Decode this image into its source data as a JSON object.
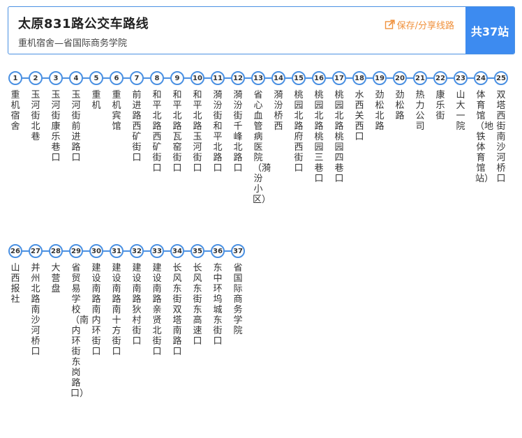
{
  "header": {
    "title": "太原831路公交车路线",
    "subtitle": "重机宿舍—省国际商务学院",
    "save_label": "保存/分享线路",
    "count_label": "共37站"
  },
  "colors": {
    "accent": "#3d8bf0",
    "line": "#4a90e2",
    "save": "#f0913c"
  },
  "rows": [
    {
      "stops": [
        {
          "num": "1",
          "name": "重机宿舍"
        },
        {
          "num": "2",
          "name": "玉河街北巷"
        },
        {
          "num": "3",
          "name": "玉河街康乐巷口"
        },
        {
          "num": "4",
          "name": "玉河街前进路口"
        },
        {
          "num": "5",
          "name": "重机"
        },
        {
          "num": "6",
          "name": "重机宾馆"
        },
        {
          "num": "7",
          "name": "前进路西矿街口"
        },
        {
          "num": "8",
          "name": "和平北路西矿街口"
        },
        {
          "num": "9",
          "name": "和平北路瓦窑街口"
        },
        {
          "num": "10",
          "name": "和平北路玉河街口"
        },
        {
          "num": "11",
          "name": "漪汾街和平北路口"
        },
        {
          "num": "12",
          "name": "漪汾街千峰北路口"
        },
        {
          "num": "13",
          "name": "省心血管病医院（漪汾小区）"
        },
        {
          "num": "14",
          "name": "漪汾桥西"
        },
        {
          "num": "15",
          "name": "桃园北路府西街口"
        },
        {
          "num": "16",
          "name": "桃园北路桃园三巷口"
        },
        {
          "num": "17",
          "name": "桃园北路桃园四巷口"
        },
        {
          "num": "18",
          "name": "水西关西口"
        },
        {
          "num": "19",
          "name": "劲松北路"
        },
        {
          "num": "20",
          "name": "劲松路"
        },
        {
          "num": "21",
          "name": "热力公司"
        },
        {
          "num": "22",
          "name": "康乐街"
        },
        {
          "num": "23",
          "name": "山大一院"
        },
        {
          "num": "24",
          "name": "体育馆（地铁体育馆站）"
        },
        {
          "num": "25",
          "name": "双塔西街南沙河桥口"
        }
      ]
    },
    {
      "stops": [
        {
          "num": "26",
          "name": "山西报社"
        },
        {
          "num": "27",
          "name": "并州北路南沙河桥口"
        },
        {
          "num": "28",
          "name": "大营盘"
        },
        {
          "num": "29",
          "name": "省贸易学校（南内环街东岗路口）"
        },
        {
          "num": "30",
          "name": "建设南路南内环街口"
        },
        {
          "num": "31",
          "name": "建设南路南十方街口"
        },
        {
          "num": "32",
          "name": "建设南路狄村街口"
        },
        {
          "num": "33",
          "name": "建设南路亲贤北街口"
        },
        {
          "num": "34",
          "name": "长风东街双塔南路口"
        },
        {
          "num": "35",
          "name": "长风东街东高速口"
        },
        {
          "num": "36",
          "name": "东中环坞城东街口"
        },
        {
          "num": "37",
          "name": "省国际商务学院"
        }
      ]
    }
  ]
}
